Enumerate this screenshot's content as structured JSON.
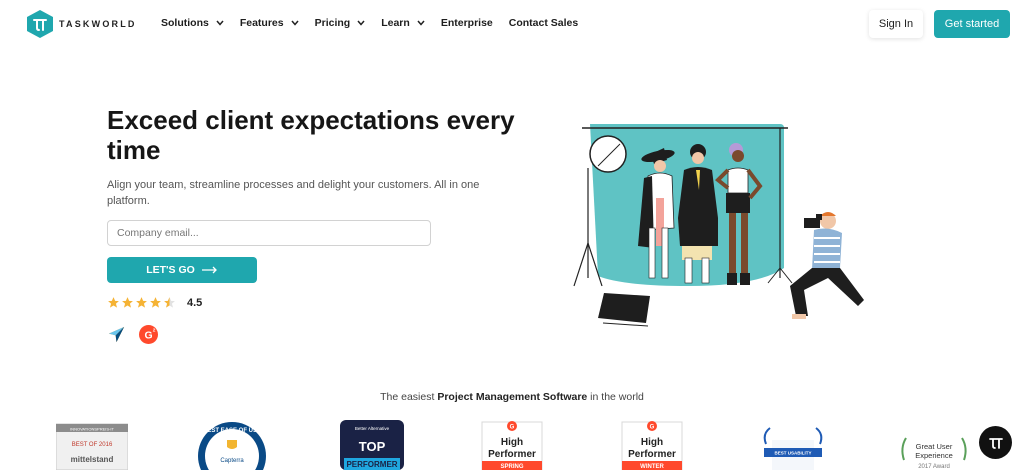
{
  "brand": {
    "name": "TASKWORLD",
    "color": "#1fa7ae"
  },
  "nav": {
    "items": [
      {
        "label": "Solutions",
        "dropdown": true
      },
      {
        "label": "Features",
        "dropdown": true
      },
      {
        "label": "Pricing",
        "dropdown": true
      },
      {
        "label": "Learn",
        "dropdown": true
      },
      {
        "label": "Enterprise",
        "dropdown": false
      },
      {
        "label": "Contact Sales",
        "dropdown": false
      }
    ],
    "sign_in": "Sign In",
    "get_started": "Get started"
  },
  "hero": {
    "title_bold": "Exceed client expectations",
    "title_rest": " every time",
    "subtitle": "Align your team, streamline processes and delight your customers. All in one platform.",
    "email_placeholder": "Company email...",
    "email_value": "",
    "cta": "LET'S GO",
    "rating_value": "4.5",
    "rating_stars": 4.5,
    "review_icons": [
      "capterra-icon",
      "g2-icon"
    ]
  },
  "awards": {
    "tagline_pre": "The easiest ",
    "tagline_bold": "Project Management Software",
    "tagline_post": " in the world",
    "items": [
      {
        "name": "innovationspreis-it",
        "lines": [
          "INNOVATIONSPREIS-IT",
          "BEST OF 2016",
          "mittelstand"
        ]
      },
      {
        "name": "capterra-best-ease-of-use",
        "lines": [
          "BEST EASE OF USE",
          "Capterra"
        ]
      },
      {
        "name": "better-alternative-top-performer",
        "lines": [
          "Better Alternative",
          "TOP",
          "PERFORMER"
        ]
      },
      {
        "name": "g2-high-performer-spring",
        "lines": [
          "High",
          "Performer",
          "SPRING"
        ]
      },
      {
        "name": "g2-high-performer-winter",
        "lines": [
          "High",
          "Performer",
          "WINTER"
        ]
      },
      {
        "name": "best-usability",
        "lines": [
          "BEST USABILITY"
        ]
      },
      {
        "name": "great-user-experience",
        "lines": [
          "Great User",
          "Experience",
          "2017 Award"
        ]
      }
    ]
  },
  "chat": {
    "icon": "chat-logo-icon"
  }
}
